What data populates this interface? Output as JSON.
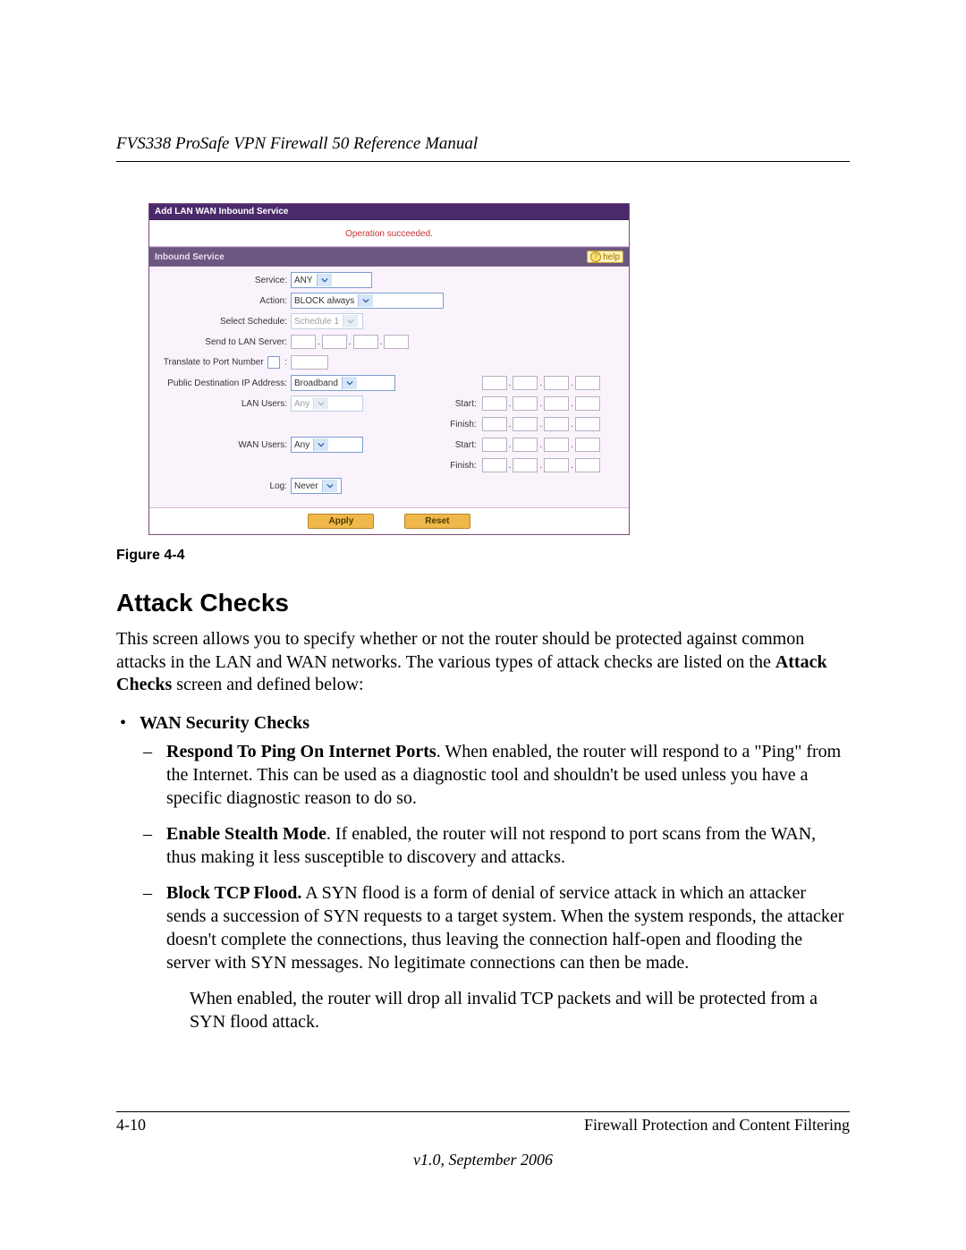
{
  "header": {
    "title": "FVS338 ProSafe VPN Firewall 50 Reference Manual"
  },
  "shot": {
    "titlebar": "Add LAN WAN Inbound Service",
    "status": "Operation succeeded.",
    "panel_title": "Inbound Service",
    "help_label": "help",
    "labels": {
      "service": "Service:",
      "action": "Action:",
      "schedule": "Select Schedule:",
      "lan_server": "Send to LAN Server:",
      "translate_port": "Translate to Port Number",
      "translate_colon": ":",
      "pub_dest": "Public Destination IP Address:",
      "lan_users": "LAN Users:",
      "wan_users": "WAN Users:",
      "log": "Log:",
      "start": "Start:",
      "finish": "Finish:"
    },
    "values": {
      "service": "ANY",
      "action": "BLOCK always",
      "schedule": "Schedule 1",
      "pub_dest": "Broadband",
      "lan_users": "Any",
      "wan_users": "Any",
      "log": "Never"
    },
    "buttons": {
      "apply": "Apply",
      "reset": "Reset"
    }
  },
  "figure_caption": "Figure 4-4",
  "section_title": "Attack Checks",
  "intro_pre": "This screen allows you to specify whether or not the router should be protected against common attacks in the LAN and WAN networks. The various types of attack checks are listed on the ",
  "intro_bold": "Attack Checks",
  "intro_post": " screen and defined below:",
  "bullet_title": "WAN Security Checks",
  "items": [
    {
      "bold": "Respond To Ping On Internet Ports",
      "rest": ". When enabled, the router will respond to a \"Ping\" from the Internet. This can be used as a diagnostic tool and shouldn't be used unless you have a specific diagnostic reason to do so."
    },
    {
      "bold": "Enable Stealth Mode",
      "rest": ". If enabled, the router will not respond to port scans from the WAN, thus making it less susceptible to discovery and attacks."
    },
    {
      "bold": "Block TCP Flood.",
      "rest": " A SYN flood is a form of denial of service attack in which an attacker sends a succession of SYN requests to a target system. When the system responds, the attacker doesn't complete the connections, thus leaving the connection half-open and flooding the server with SYN messages. No legitimate connections can then be made."
    }
  ],
  "follow_text": "When enabled, the router will drop all invalid TCP packets and will be protected from a SYN flood attack.",
  "footer": {
    "page": "4-10",
    "section": "Firewall Protection and Content Filtering",
    "version": "v1.0, September 2006"
  }
}
